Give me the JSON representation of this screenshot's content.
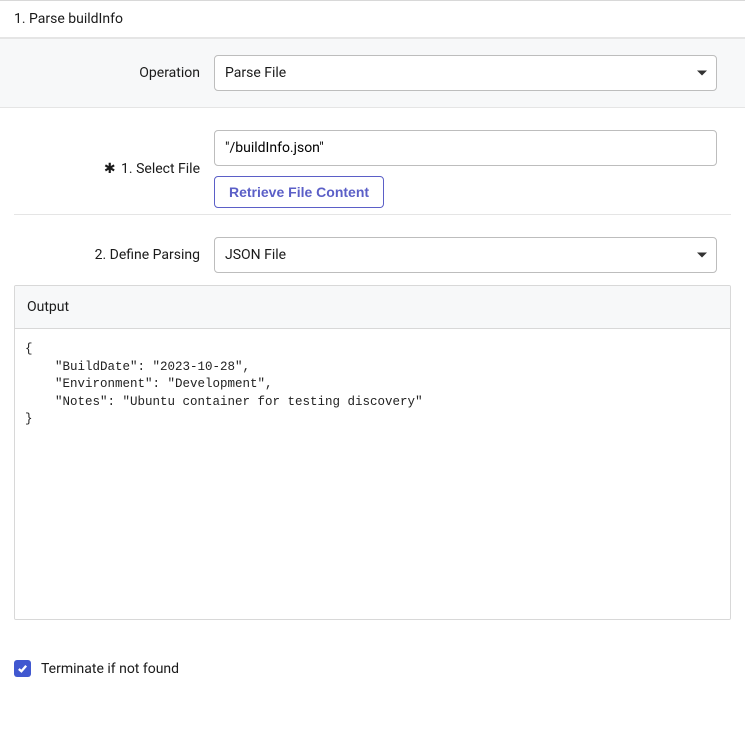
{
  "header": {
    "title": "1. Parse buildInfo"
  },
  "operation": {
    "label": "Operation",
    "value": "Parse File"
  },
  "selectFile": {
    "label": "1. Select File",
    "value": "\"/buildInfo.json\"",
    "button": "Retrieve File Content"
  },
  "defineParsing": {
    "label": "2. Define Parsing",
    "value": "JSON File"
  },
  "output": {
    "label": "Output",
    "content": "{\n    \"BuildDate\": \"2023-10-28\",\n    \"Environment\": \"Development\",\n    \"Notes\": \"Ubuntu container for testing discovery\"\n}"
  },
  "terminate": {
    "label": "Terminate if not found",
    "checked": true
  }
}
